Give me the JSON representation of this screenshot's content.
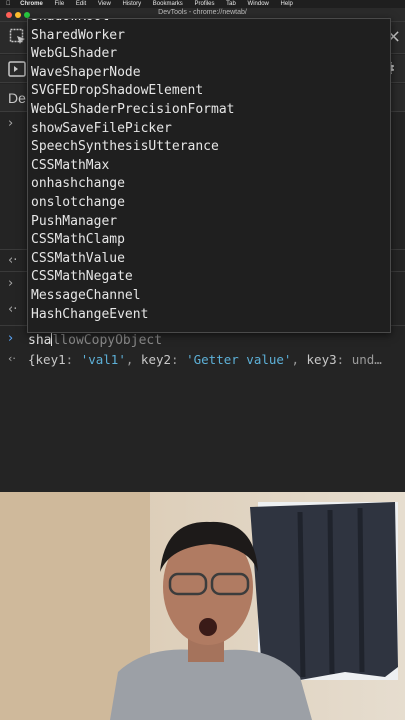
{
  "menubar": {
    "apple": "",
    "items": [
      "Chrome",
      "File",
      "Edit",
      "View",
      "History",
      "Bookmarks",
      "Profiles",
      "Tab",
      "Window",
      "Help"
    ]
  },
  "window": {
    "title": "DevTools - chrome://newtab/"
  },
  "devtools": {
    "tab_label_truncated": "De",
    "autocomplete": {
      "items": [
        "ShadowRoot",
        "SharedWorker",
        "WebGLShader",
        "WaveShaperNode",
        "SVGFEDropShadowElement",
        "WebGLShaderPrecisionFormat",
        "showSaveFilePicker",
        "SpeechSynthesisUtterance",
        "CSSMathMax",
        "onhashchange",
        "onslotchange",
        "PushManager",
        "CSSMathClamp",
        "CSSMathValue",
        "CSSMathNegate",
        "MessageChannel",
        "HashChangeEvent"
      ]
    },
    "input": {
      "typed": "sha",
      "suggestion_rest": "llowCopyObject"
    },
    "result": {
      "open": "{",
      "k1": "key1",
      "v1": "'val1'",
      "k2": "key2",
      "v2": "'Getter value'",
      "k3": "key3",
      "tail": "und…"
    }
  },
  "icons": [
    "select-element-icon",
    "device-toolbar-icon",
    "settings-gear-icon",
    "more-icon",
    "sidebar-toggle-icon"
  ],
  "colors": {
    "console_bg": "#242424",
    "string_blue": "#5db0d7",
    "prompt_blue": "#5aa9ff"
  }
}
